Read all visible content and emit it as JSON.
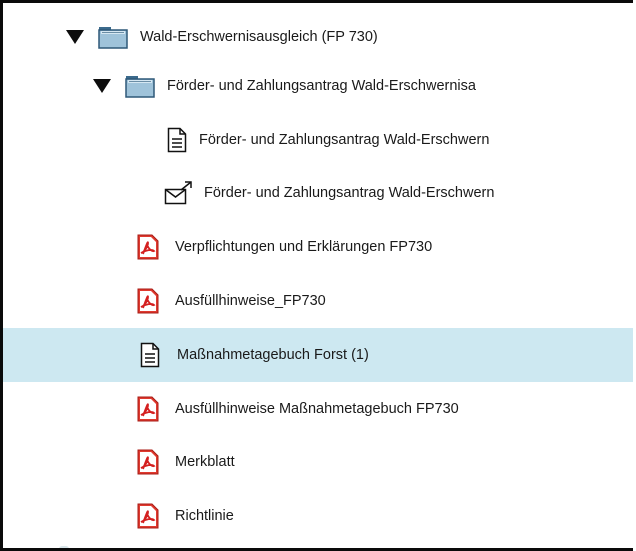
{
  "tree": {
    "items": [
      {
        "label": "Wald-Erschwernisausgleich (FP 730)",
        "icon": "folder-icon",
        "expanded": true
      },
      {
        "label": "Förder- und Zahlungsantrag Wald-Erschwernisa",
        "icon": "folder-icon",
        "expanded": true
      },
      {
        "label": "Förder- und Zahlungsantrag Wald-Erschwern",
        "icon": "document-icon"
      },
      {
        "label": "Förder- und Zahlungsantrag Wald-Erschwern",
        "icon": "send-mail-icon"
      },
      {
        "label": "Verpflichtungen und Erklärungen FP730",
        "icon": "pdf-icon"
      },
      {
        "label": "Ausfüllhinweise_FP730",
        "icon": "pdf-icon"
      },
      {
        "label": "Maßnahmetagebuch Forst (1)",
        "icon": "document-icon",
        "selected": true
      },
      {
        "label": "Ausfüllhinweise Maßnahmetagebuch FP730",
        "icon": "pdf-icon"
      },
      {
        "label": "Merkblatt",
        "icon": "pdf-icon"
      },
      {
        "label": "Richtlinie",
        "icon": "pdf-icon"
      }
    ]
  },
  "colors": {
    "selected_background": "#cde8f1",
    "pdf_red": "#d42020",
    "folder_blue": "#9fc3da"
  }
}
